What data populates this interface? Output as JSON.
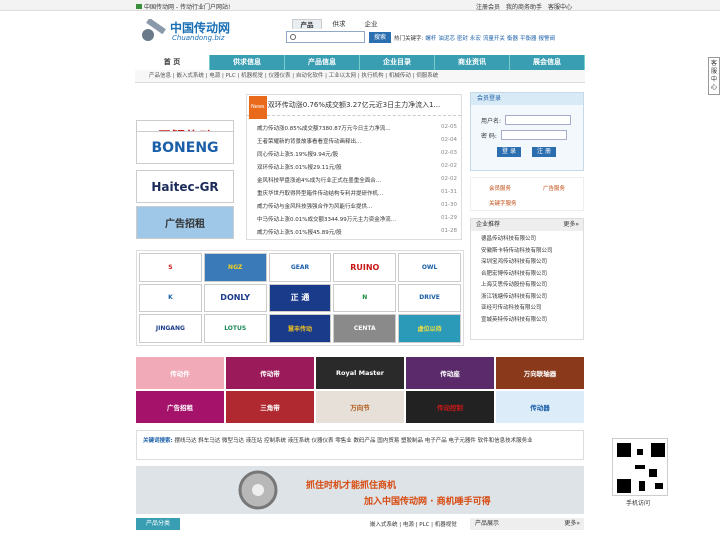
{
  "topbar": {
    "site": "中国传动网 - 传动行业门户网站!",
    "links": [
      "注册会员",
      "我的商务助手",
      "客服中心"
    ]
  },
  "logo": {
    "cn": "中国传动网",
    "en": "Chuandong.biz"
  },
  "search": {
    "tabs": [
      "产品",
      "供求",
      "企业"
    ],
    "placeholder": "",
    "button": "搜索",
    "hot_label": "热门关键字:",
    "hot": [
      "螺杆",
      "油泥芯",
      "密封",
      "永宏",
      "流量开关",
      "衡器",
      "平衡器",
      "报警阀"
    ]
  },
  "nav": [
    "首 页",
    "供求信息",
    "产品信息",
    "企业目录",
    "商业资讯",
    "展会信息"
  ],
  "subnav": "产品信息 | 嵌入式系统 | 电源 | PLC | 机器视觉 | 仪器仪表 | 自动化软件 | 工业以太网 | 执行机构 | 机械传动 | 伺服系统",
  "side": "客服中心",
  "left_ads": [
    "巨蟹传动",
    "BONENG",
    "Haitec-GR",
    "广告招租"
  ],
  "news": {
    "tag": "News",
    "headline": "双环传动涨0.76%成交额3.27亿元近3日主力净流入1...",
    "items": [
      {
        "t": "威力传动涨0.85%成交额7380.87万元今日主力净流...",
        "d": "02-05"
      },
      {
        "t": "王者荣耀新的背景故事看看宣传动画释出...",
        "d": "02-04"
      },
      {
        "t": "同心传动上涨5.19%报9.94元/股",
        "d": "02-03"
      },
      {
        "t": "双环传动上涨5.01%报29.11元/股",
        "d": "02-02"
      },
      {
        "t": "金风科技早盘涨逾4%成为行业正式在墨重全面合...",
        "d": "02-02"
      },
      {
        "t": "重庆华世丹取得异型箱件传动结构专利并提研作机...",
        "d": "01-31"
      },
      {
        "t": "威力传动与金风科技强强合作为风能行业提供...",
        "d": "01-30"
      },
      {
        "t": "中马传动上涨0.01%成交额3344.99万元主力资金净流...",
        "d": "01-29"
      },
      {
        "t": "威力传动上涨5.01%报45.89元/股",
        "d": "01-28"
      }
    ]
  },
  "login": {
    "title": "会员登录",
    "user": "用户名:",
    "pwd": "密  码:",
    "btn_login": "登 录",
    "btn_reg": "注 册"
  },
  "services": [
    "会员服务",
    "广告服务",
    "关键字服务"
  ],
  "companies": {
    "title": "企业推荐",
    "more": "更多»",
    "items": [
      "德昌传动科技有限公司",
      "安徽斯卡特传动科技有限公司",
      "深圳宝鸿传动科技有限公司",
      "合肥宏博传动科技有限公司",
      "上海艾思传动股份有限公司",
      "浙江钱塘传动科技有限公司",
      "亚经可传动科技有限公司",
      "宣城英特传动科技有限公司"
    ]
  },
  "logo_wall": [
    "S",
    "NGZ",
    "GEAR",
    "RUINO",
    "OWL",
    "K",
    "DONLY",
    "正 通",
    "N",
    "DRIVE",
    "JINGANG",
    "LOTUS",
    "慧丰传动",
    "CENTA",
    "虚位以待"
  ],
  "band": [
    {
      "t": "传动件",
      "c": "#f1aab8"
    },
    {
      "t": "传动带",
      "c": "#9b1a5a"
    },
    {
      "t": "Royal Master",
      "c": "#2a2a2a"
    },
    {
      "t": "传动座",
      "c": "#5a2a6a"
    },
    {
      "t": "万向联轴器",
      "c": "#8a3a1a"
    },
    {
      "t": "广告招租",
      "c": "#a5126a"
    },
    {
      "t": "三角带",
      "c": "#b02830"
    },
    {
      "t": "万向节",
      "c": "#e6e0d8"
    },
    {
      "t": "传动控制",
      "c": "#222222"
    },
    {
      "t": "传动器",
      "c": "#dcecf8"
    }
  ],
  "keywords": {
    "label": "关键词搜索:",
    "text": "摆线马达  斜车马达  微型马达  液压站  控制系统  液压系统  仪器仪表  零售业  数码产品  国内贸易  塑胶制品  电子产品  电子元器件  软件和信息技术服务业"
  },
  "banner": {
    "a": "抓住时机才能抓住商机",
    "b": "加入中国传动网 · 商机唾手可得"
  },
  "qr_label": "手机访问",
  "bottom": {
    "cat": "产品分类",
    "links": "嵌入式系统 | 电源 | PLC | 机器视觉",
    "show": "产品展示",
    "more": "更多»"
  }
}
